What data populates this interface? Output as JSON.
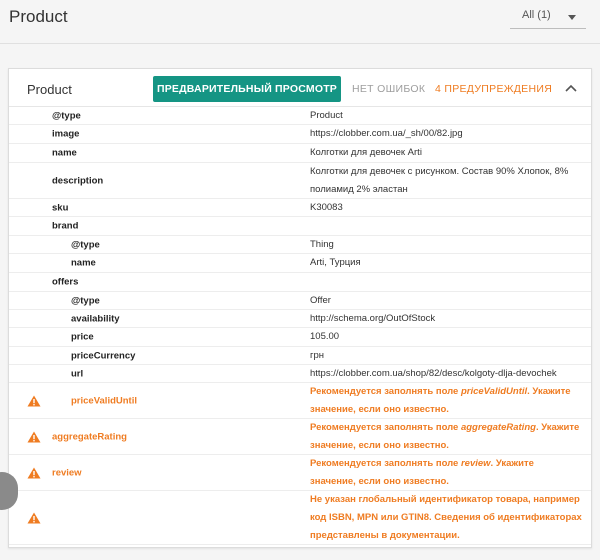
{
  "page": {
    "title": "Product"
  },
  "filter": {
    "label": "All (1)"
  },
  "card": {
    "title": "Product",
    "preview_button": "ПРЕДВАРИТЕЛЬНЫЙ ПРОСМОТР",
    "errors": "НЕТ ОШИБОК",
    "warnings": "4 ПРЕДУПРЕЖДЕНИЯ"
  },
  "rows": [
    {
      "key": "@type",
      "value": "Product",
      "level": 0,
      "warn": false,
      "h": 18
    },
    {
      "key": "image",
      "value": "https://clobber.com.ua/_sh/00/82.jpg",
      "level": 0,
      "warn": false,
      "h": 19
    },
    {
      "key": "name",
      "value": "Колготки для девочек Arti",
      "level": 0,
      "warn": false,
      "h": 19
    },
    {
      "key": "description",
      "value": "Колготки для девочек с рисунком. Состав 90% Хлопок, 8% полиамид 2% эластан",
      "level": 0,
      "warn": false,
      "h": 36
    },
    {
      "key": "sku",
      "value": "K30083",
      "level": 0,
      "warn": false,
      "h": 18
    },
    {
      "key": "brand",
      "value": "",
      "level": 0,
      "warn": false,
      "h": 19
    },
    {
      "key": "@type",
      "value": "Thing",
      "level": 1,
      "warn": false,
      "h": 18
    },
    {
      "key": "name",
      "value": "Arti, Турция",
      "level": 1,
      "warn": false,
      "h": 19
    },
    {
      "key": "offers",
      "value": "",
      "level": 0,
      "warn": false,
      "h": 19
    },
    {
      "key": "@type",
      "value": "Offer",
      "level": 1,
      "warn": false,
      "h": 18
    },
    {
      "key": "availability",
      "value": "http://schema.org/OutOfStock",
      "level": 1,
      "warn": false,
      "h": 18
    },
    {
      "key": "price",
      "value": "105.00",
      "level": 1,
      "warn": false,
      "h": 19
    },
    {
      "key": "priceCurrency",
      "value": "грн",
      "level": 1,
      "warn": false,
      "h": 18
    },
    {
      "key": "url",
      "value": "https://clobber.com.ua/shop/82/desc/kolgoty-dlja-devochek",
      "level": 1,
      "warn": false,
      "h": 18
    },
    {
      "key": "priceValidUntil",
      "value": "",
      "level": 1,
      "warn": true,
      "h": 36,
      "msg_pre": "Рекомендуется заполнять поле ",
      "msg_field": "priceValidUntil",
      "msg_post": ". Укажите значение, если оно известно."
    },
    {
      "key": "aggregateRating",
      "value": "",
      "level": 0,
      "warn": true,
      "h": 36,
      "msg_pre": "Рекомендуется заполнять поле ",
      "msg_field": "aggregateRating",
      "msg_post": ". Укажите значение, если оно известно."
    },
    {
      "key": "review",
      "value": "",
      "level": 0,
      "warn": true,
      "h": 36,
      "msg_pre": "Рекомендуется заполнять поле ",
      "msg_field": "review",
      "msg_post": ". Укажите значение, если оно известно."
    },
    {
      "key": "",
      "value": "",
      "level": 0,
      "warn": true,
      "h": 54,
      "msg_pre": "Не указан глобальный идентификатор товара, например код ISBN, MPN или GTIN8. Сведения об идентификаторах представлены в документации.",
      "msg_field": "",
      "msg_post": ""
    }
  ],
  "colors": {
    "accent": "#159584",
    "warning": "#ef7c22"
  }
}
